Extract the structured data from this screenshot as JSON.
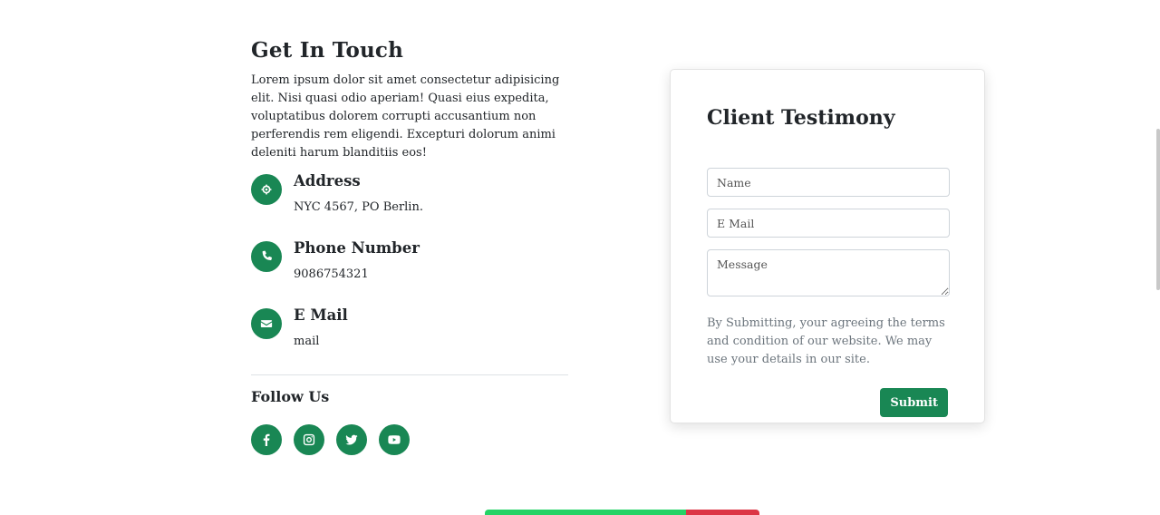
{
  "contact": {
    "title": "Get In Touch",
    "intro": "Lorem ipsum dolor sit amet consectetur adipisicing elit. Nisi quasi odio aperiam! Quasi eius expedita, voluptatibus dolorem corrupti accusantium non perferendis rem eligendi. Excepturi dolorum animi deleniti harum blanditiis eos!",
    "items": [
      {
        "icon": "location-icon",
        "label": "Address",
        "value": "NYC 4567, PO Berlin."
      },
      {
        "icon": "phone-icon",
        "label": "Phone Number",
        "value": "9086754321"
      },
      {
        "icon": "envelope-icon",
        "label": "E Mail",
        "value": "mail"
      }
    ]
  },
  "follow": {
    "title": "Follow Us",
    "icons": [
      "facebook-icon",
      "instagram-icon",
      "twitter-icon",
      "youtube-icon"
    ]
  },
  "form": {
    "title": "Client Testimony",
    "name_placeholder": "Name",
    "email_placeholder": "E Mail",
    "message_placeholder": "Message",
    "note": "By Submitting, your agreeing the terms and condition of our website. We may use your details in our site.",
    "submit_label": "Submit"
  },
  "colors": {
    "accent": "#198754",
    "whatsapp_green": "#25d366",
    "red": "#dc3545"
  }
}
